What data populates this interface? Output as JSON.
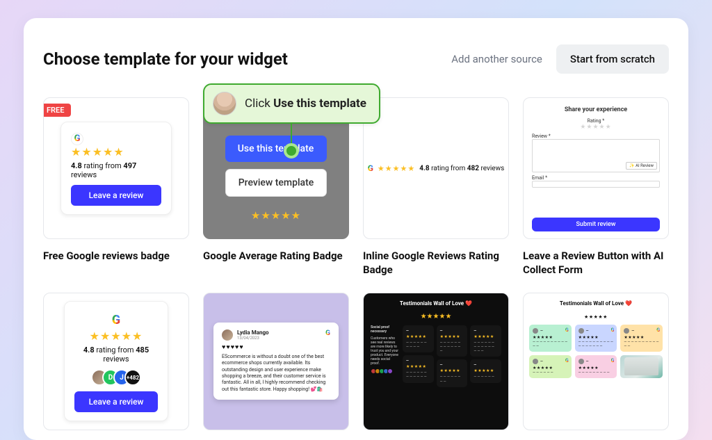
{
  "header": {
    "title": "Choose template for your widget",
    "add_source": "Add another source",
    "start_scratch": "Start from scratch"
  },
  "callout": {
    "prefix": "Click ",
    "strong": "Use this template"
  },
  "hover": {
    "use": "Use this template",
    "preview": "Preview template"
  },
  "cards": {
    "c1": {
      "free": "FREE",
      "rating": "4.8",
      "mid": " rating from ",
      "count": "497",
      "suffix": " reviews",
      "cta": "Leave a review",
      "title": "Free Google reviews badge"
    },
    "c2": {
      "title": "Google Average Rating Badge"
    },
    "c3": {
      "rating": "4.8",
      "mid": " rating from ",
      "count": "482",
      "suffix": " reviews",
      "title": "Inline Google Reviews Rating Badge"
    },
    "c4": {
      "form_title": "Share your experience",
      "rating_lbl": "Rating *",
      "review_lbl": "Review *",
      "ai": "✨ AI Review",
      "email_lbl": "Email *",
      "submit": "Submit review",
      "title": "Leave a Review Button with AI Collect Form"
    },
    "c5": {
      "rating": "4.8",
      "mid": " rating from ",
      "count": "485",
      "suffix": " reviews",
      "plus": "+482",
      "cta": "Leave a review"
    },
    "c6": {
      "author": "Lydia Mango",
      "date": "13/04/2023",
      "body": "EScommerce is without a doubt one of the best ecommerce shops currently available. Its outstanding design and user experience make shopping a breeze, and their customer service is fantastic. All in all, I highly recommend checking out this fantastic store. Happy shopping! 💕🛍️"
    },
    "c7": {
      "wall_title": "Testimonials Wall of Love ❤️",
      "sp_title": "Social proof necessary",
      "sp_body": "Customers who see real reviews are more likely to trust you and your product. Everyone needs social proof."
    },
    "c8": {
      "wall_title": "Testimonials Wall of Love ❤️"
    }
  }
}
